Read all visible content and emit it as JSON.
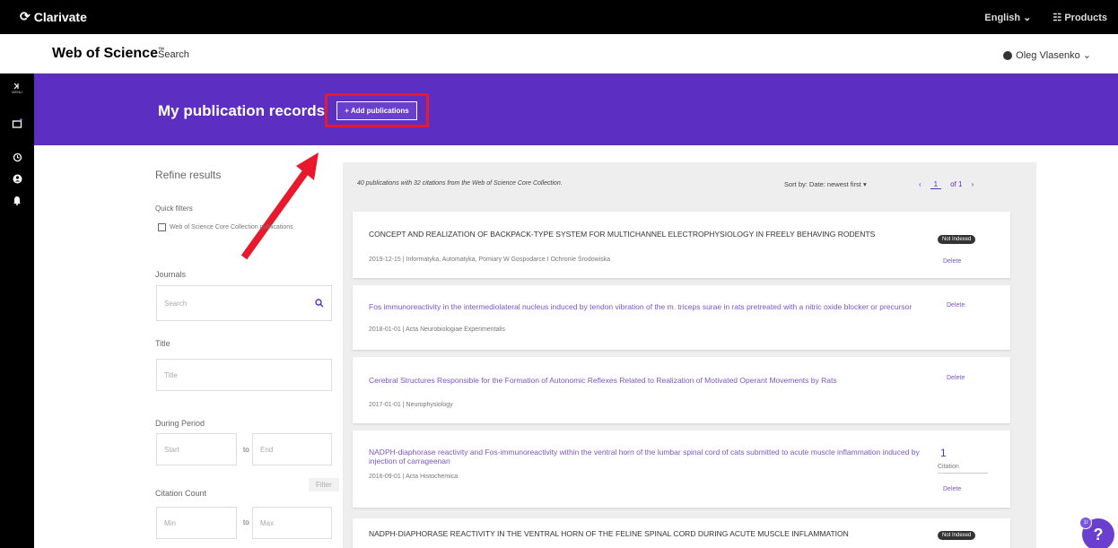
{
  "topbar": {
    "brand": "Clarivate",
    "language": "English ⌄",
    "products": "☷ Products"
  },
  "header": {
    "logo": "Web of Science",
    "logo_tm": "™",
    "nav_search": "Search",
    "user_name": "Oleg Vlasenko ⌄"
  },
  "rail": {
    "menu_label": "MENU"
  },
  "banner": {
    "title": "My publication records",
    "add_button": "+ Add publications"
  },
  "refine": {
    "title": "Refine results",
    "quick_filters_label": "Quick filters",
    "wos_checkbox_label": "Web of Science Core Collection publications",
    "journals_label": "Journals",
    "journals_placeholder": "Search",
    "title_label": "Title",
    "title_placeholder": "Title",
    "period_label": "During Period",
    "start_placeholder": "Start",
    "end_placeholder": "End",
    "to_label": "to",
    "filter_button": "Filter",
    "citation_label": "Citation Count",
    "min_placeholder": "Min",
    "max_placeholder": "Max"
  },
  "results": {
    "summary": "40 publications with 32 citations from the Web of Science Core Collection.",
    "sort_label": "Sort by: Date: newest first ▾",
    "pager_prev": "‹",
    "pager_page": "1",
    "pager_of": "of 1",
    "pager_next": "›",
    "items": [
      {
        "title": "CONCEPT AND REALIZATION OF BACKPACK-TYPE SYSTEM FOR MULTICHANNEL ELECTROPHYSIOLOGY IN FREELY BEHAVING RODENTS",
        "meta": "2019-12-15 | Informatyka, Automatyka, Pomiary W Gospodarce I Ochronie Środowiska",
        "badge": "Not Indexed",
        "delete": "Delete"
      },
      {
        "title": "Fos immunoreactivity in the intermediolateral nucleus induced by tendon vibration of the m. triceps surae in rats pretreated with a nitric oxide blocker or precursor",
        "meta": "2018-01-01 | Acta Neurobiologiae Experimentalis",
        "delete": "Delete"
      },
      {
        "title": "Cerebral Structures Responsible for the Formation of Autonomic Reflexes Related to Realization of Motivated Operant Movements by Rats",
        "meta": "2017-01-01 | Neurophysiology",
        "delete": "Delete"
      },
      {
        "title": "NADPH-diaphorase reactivity and Fos-immunoreactivity within the ventral horn of the lumbar spinal cord of cats submitted to acute muscle inflammation induced by injection of carrageenan",
        "meta": "2016-09-01 | Acta Histochemica",
        "cite_count": "1",
        "cite_label": "Citation",
        "delete": "Delete"
      },
      {
        "title": "NADPH-DIAPHORASE REACTIVITY IN THE VENTRAL HORN OF THE FELINE SPINAL CORD DURING ACUTE MUSCLE INFLAMMATION",
        "badge": "Not Indexed"
      }
    ]
  },
  "help": {
    "glyph": "?",
    "badge": "1/"
  },
  "colors": {
    "banner": "#5c2fc2",
    "highlight": "#e8192c",
    "link": "#7a55c8"
  }
}
